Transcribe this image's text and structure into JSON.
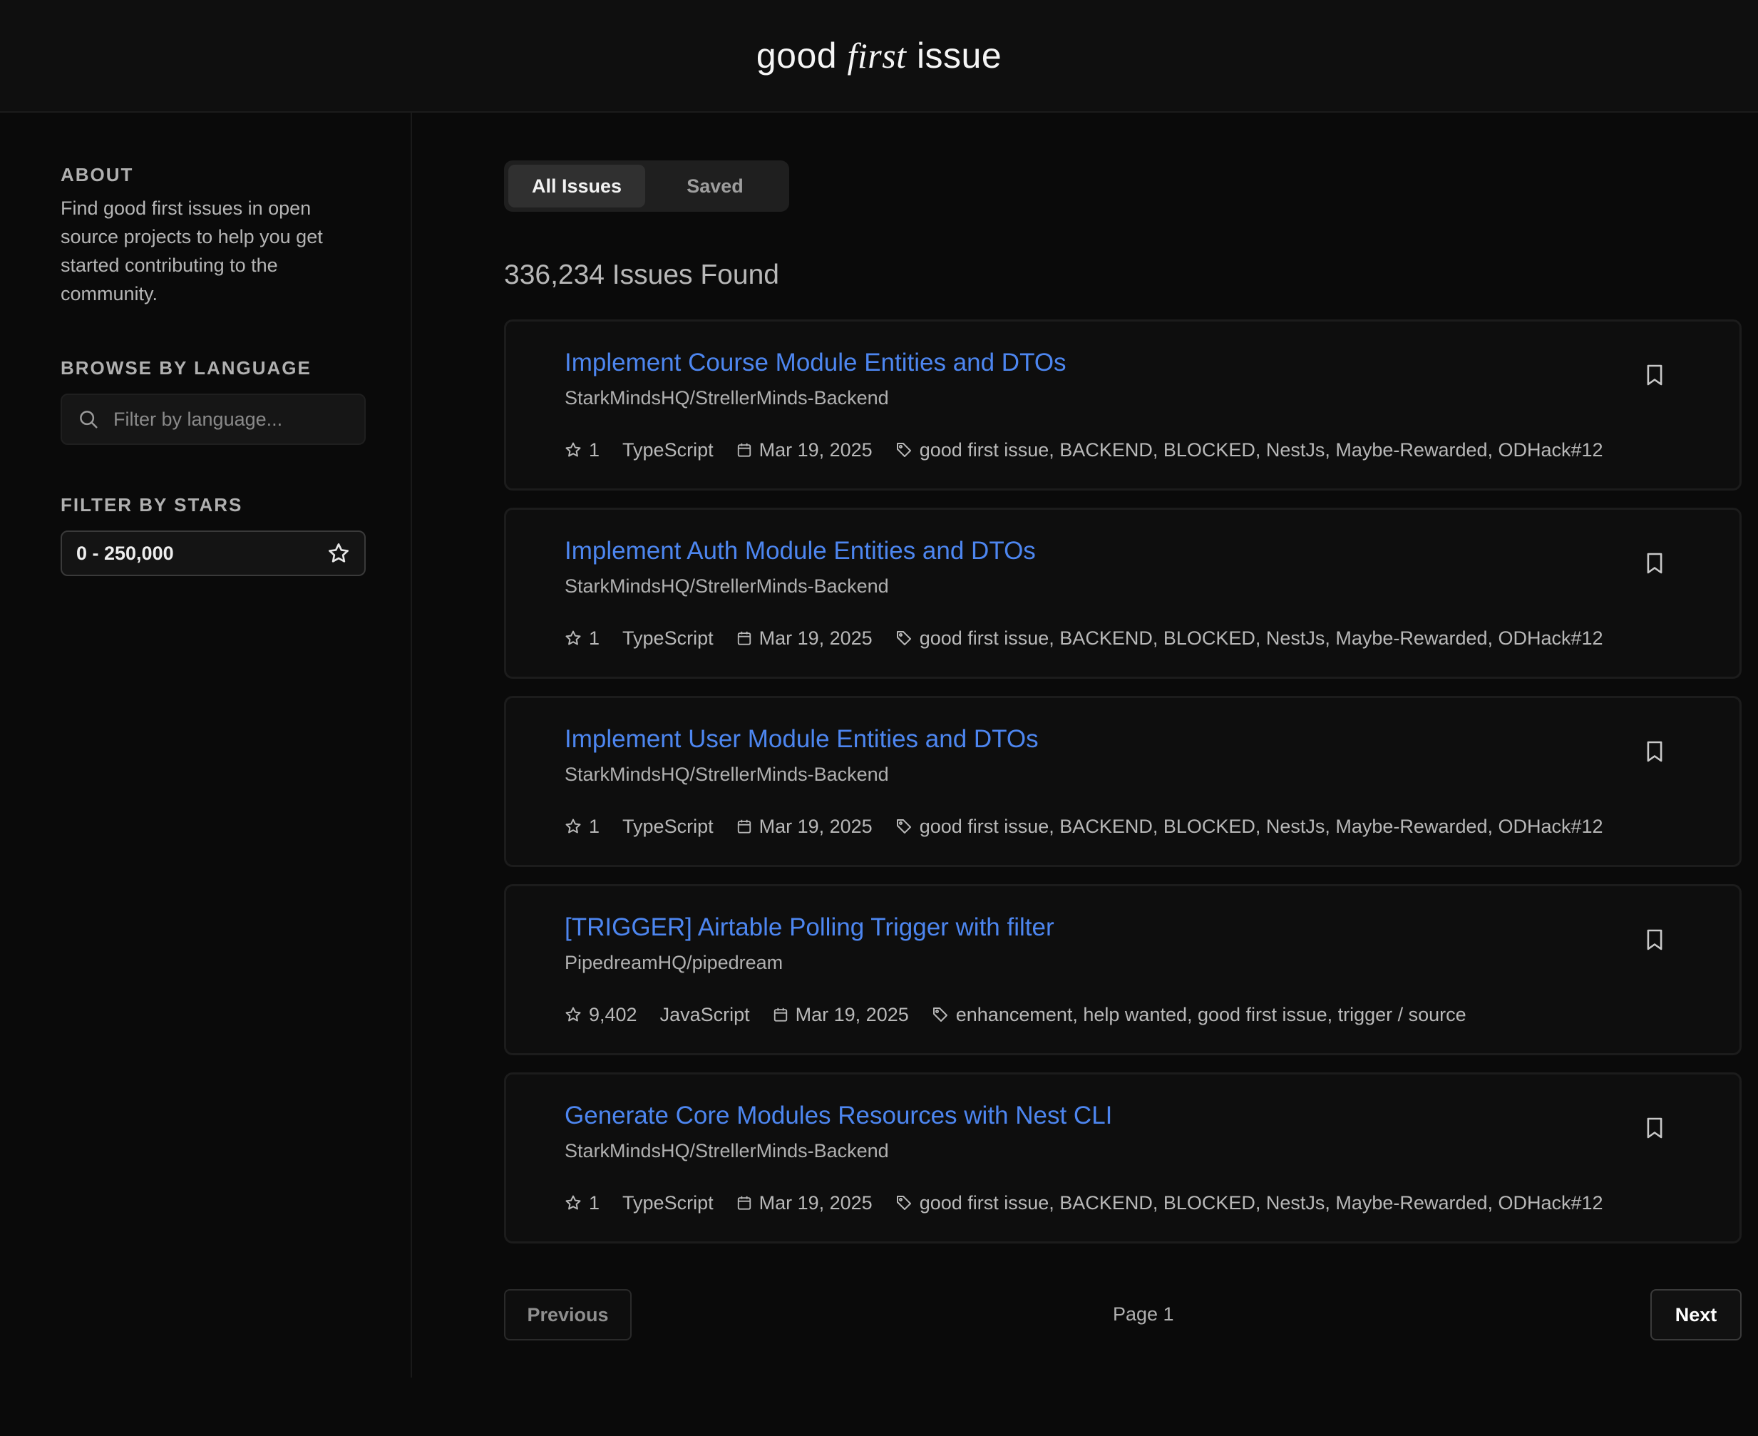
{
  "app": {
    "brand_part1": "good ",
    "brand_part2": "first",
    "brand_part3": " issue"
  },
  "sidebar": {
    "about_heading": "ABOUT",
    "about_text": "Find good first issues in open source projects to help you get started contributing to the community.",
    "language_heading": "BROWSE BY LANGUAGE",
    "language_placeholder": "Filter by language...",
    "language_value": "",
    "stars_heading": "FILTER BY STARS",
    "stars_value": "0 - 250,000"
  },
  "tabs": [
    {
      "label": "All Issues",
      "active": true
    },
    {
      "label": "Saved",
      "active": false
    }
  ],
  "results_label": "336,234 Issues Found",
  "issues": [
    {
      "title": "Implement Course Module Entities and DTOs",
      "repo": "StarkMindsHQ/StrellerMinds-Backend",
      "stars": "1",
      "language": "TypeScript",
      "date": "Mar 19, 2025",
      "labels": "good first issue, BACKEND, BLOCKED, NestJs, Maybe-Rewarded, ODHack#12"
    },
    {
      "title": "Implement Auth Module Entities and DTOs",
      "repo": "StarkMindsHQ/StrellerMinds-Backend",
      "stars": "1",
      "language": "TypeScript",
      "date": "Mar 19, 2025",
      "labels": "good first issue, BACKEND, BLOCKED, NestJs, Maybe-Rewarded, ODHack#12"
    },
    {
      "title": "Implement User Module Entities and DTOs",
      "repo": "StarkMindsHQ/StrellerMinds-Backend",
      "stars": "1",
      "language": "TypeScript",
      "date": "Mar 19, 2025",
      "labels": "good first issue, BACKEND, BLOCKED, NestJs, Maybe-Rewarded, ODHack#12"
    },
    {
      "title": "[TRIGGER] Airtable Polling Trigger with filter",
      "repo": "PipedreamHQ/pipedream",
      "stars": "9,402",
      "language": "JavaScript",
      "date": "Mar 19, 2025",
      "labels": "enhancement, help wanted, good first issue, trigger / source"
    },
    {
      "title": "Generate Core Modules Resources with Nest CLI",
      "repo": "StarkMindsHQ/StrellerMinds-Backend",
      "stars": "1",
      "language": "TypeScript",
      "date": "Mar 19, 2025",
      "labels": "good first issue, BACKEND, BLOCKED, NestJs, Maybe-Rewarded, ODHack#12"
    }
  ],
  "pagination": {
    "previous_label": "Previous",
    "page_label": "Page 1",
    "next_label": "Next"
  },
  "icons": {
    "search": "search-icon",
    "star": "star-icon",
    "calendar": "calendar-icon",
    "tag": "tag-icon",
    "bookmark": "bookmark-icon"
  },
  "colors": {
    "background": "#0a0a0a",
    "accent_link": "#4d86f0",
    "text_muted": "#b0b0b0"
  }
}
